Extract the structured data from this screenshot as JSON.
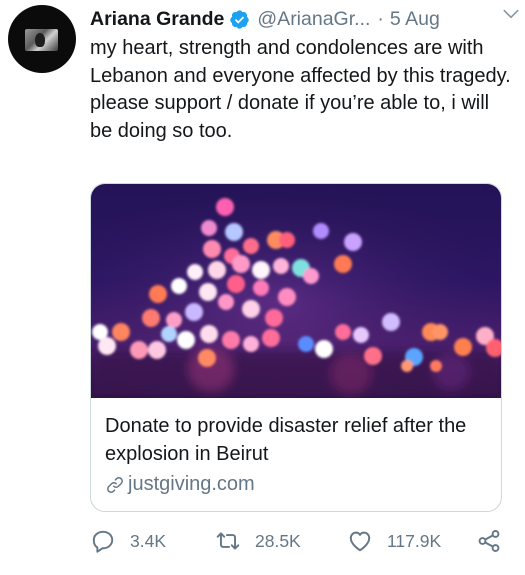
{
  "tweet": {
    "author_name": "Ariana Grande",
    "handle": "@ArianaGr...",
    "separator": "·",
    "timestamp": "5 Aug",
    "text_lines": [
      "my heart, strength and condolences are with Lebanon and everyone affected by this tragedy.",
      "please support / donate if you’re able to, i will be doing so too."
    ]
  },
  "card": {
    "title": "Donate to provide disaster relief after the explosion in Beirut",
    "domain": "justgiving.com"
  },
  "actions": {
    "replies": "3.4K",
    "retweets": "28.5K",
    "likes": "117.9K"
  },
  "colors": {
    "verified_badge": "#1da1f2",
    "secondary_text": "#657786",
    "primary_text": "#14171a",
    "card_border": "#ccd6dd"
  },
  "icons": [
    "verified-icon",
    "chevron-down-icon",
    "link-icon",
    "reply-icon",
    "retweet-icon",
    "like-icon",
    "share-icon"
  ]
}
